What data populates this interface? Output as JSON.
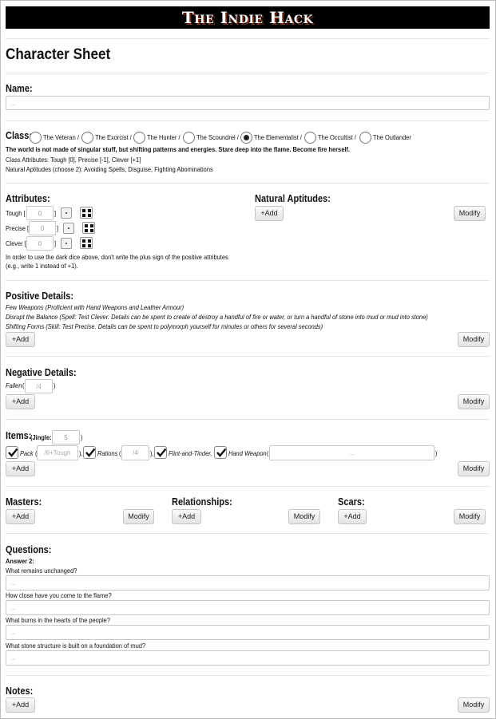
{
  "banner": {
    "title": "The Indie Hack"
  },
  "page": {
    "title": "Character Sheet"
  },
  "name": {
    "label": "Name",
    "placeholder": "..."
  },
  "class": {
    "label": "Class",
    "options": [
      {
        "label": "The Veteran",
        "selected": false
      },
      {
        "label": "The Exorcist",
        "selected": false
      },
      {
        "label": "The Hunter",
        "selected": false
      },
      {
        "label": "The Scoundrel",
        "selected": false
      },
      {
        "label": "The Elementalist",
        "selected": true
      },
      {
        "label": "The Occultist",
        "selected": false
      },
      {
        "label": "The Outlander",
        "selected": false
      }
    ],
    "separator": "/",
    "flavor": "The world is not made of singular stuff, but shifting patterns and energies. Stare deep into the flame. Become fire herself.",
    "attributes_line": "Class Attributes: Tough [0], Precise [-1], Clever [+1]",
    "aptitudes_line": "Natural Aptitudes (choose 2): Avoiding Spells, Disguise, Fighting Abominations"
  },
  "attributes": {
    "heading": "Attributes",
    "rows": [
      {
        "label": "Tough",
        "value": "0"
      },
      {
        "label": "Precise",
        "value": "0"
      },
      {
        "label": "Clever",
        "value": "0"
      }
    ],
    "note_line1": "In order to use the dark dice above, don't write the plus sign of the positive attributes",
    "note_line2": "(e.g., write 1 instead of +1).",
    "bracket_open": "[",
    "bracket_close": "]"
  },
  "natural_aptitudes": {
    "heading": "Natural Aptitudes",
    "add_label": "+Add",
    "modify_label": "Modify"
  },
  "positive_details": {
    "heading": "Positive Details",
    "items": [
      "Few Weapons (Proficient with Hand Weapons and Leather Armour)",
      "Disrupt the Balance (Spell: Test Clever. Details can be spent to create of destroy a handful of fire or water, or turn a handful of stone into mud or mud into stone)",
      "Shifting Forms (Skill: Test Precise. Details can be spent to polymorph yourself for minutes or others for several seconds)"
    ],
    "add_label": "+Add",
    "modify_label": "Modify"
  },
  "negative_details": {
    "heading": "Negative Details",
    "fallen_label": "Fallen",
    "fallen_placeholder": "/4",
    "add_label": "+Add",
    "modify_label": "Modify"
  },
  "items": {
    "heading": "Items",
    "jingle_label": "Jingle",
    "jingle_value": "5",
    "entries": [
      {
        "label": "Pack",
        "placeholder": "/6+Tough",
        "checked": true
      },
      {
        "label": "Rations",
        "placeholder": "/4",
        "checked": true
      },
      {
        "label": "Flint-and-Tinder,",
        "checked": true
      },
      {
        "label": "Hand Weapon",
        "placeholder": "...",
        "checked": true
      }
    ],
    "add_label": "+Add",
    "modify_label": "Modify"
  },
  "masters": {
    "heading": "Masters",
    "add_label": "+Add",
    "modify_label": "Modify"
  },
  "relationships": {
    "heading": "Relationships",
    "add_label": "+Add",
    "modify_label": "Modify"
  },
  "scars": {
    "heading": "Scars",
    "add_label": "+Add",
    "modify_label": "Modify"
  },
  "questions": {
    "heading": "Questions",
    "instruction": "Answer 2",
    "items": [
      {
        "question": "What remains unchanged?",
        "placeholder": "..."
      },
      {
        "question": "How close have you come to the flame?",
        "placeholder": "..."
      },
      {
        "question": "What burns in the hearts of the people?",
        "placeholder": "..."
      },
      {
        "question": "What stone structure is built on a foundation of mud?",
        "placeholder": "..."
      }
    ]
  },
  "notes": {
    "heading": "Notes",
    "add_label": "+Add",
    "modify_label": "Modify"
  },
  "colors": {
    "banner_bg": "#000000",
    "banner_text": "#ffffff",
    "banner_shadow": "#7a2a10"
  }
}
